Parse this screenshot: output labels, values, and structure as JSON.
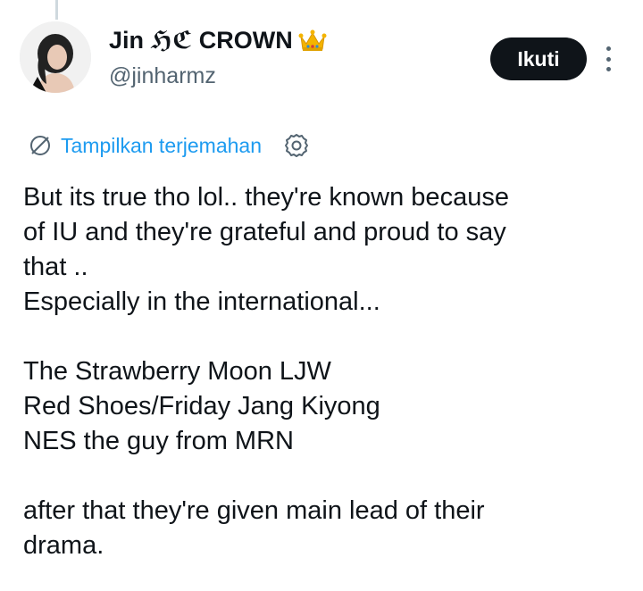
{
  "author": {
    "display_name": "Jin ℌℭ CROWN",
    "verified_badge_icon": "crown-emoji-icon",
    "handle": "@jinharmz",
    "avatar_icon": "profile-photo"
  },
  "actions": {
    "follow_label": "Ikuti",
    "more_icon": "vertical-ellipsis-icon"
  },
  "translation": {
    "label": "Tampilkan terjemahan",
    "translate_icon": "translate-icon",
    "settings_icon": "gear-icon"
  },
  "tweet": {
    "lines": [
      "But its true tho lol.. they're known because",
      "of IU and they're grateful and proud to say",
      "that ..",
      "Especially in the international...",
      "",
      "The Strawberry Moon LJW",
      "Red Shoes/Friday Jang Kiyong",
      "NES the guy from MRN",
      "",
      "after that they're given main lead of their",
      "drama."
    ]
  },
  "colors": {
    "link": "#1d9bf0",
    "text": "#0f1419",
    "secondary": "#536471",
    "button_bg": "#0f1419"
  }
}
